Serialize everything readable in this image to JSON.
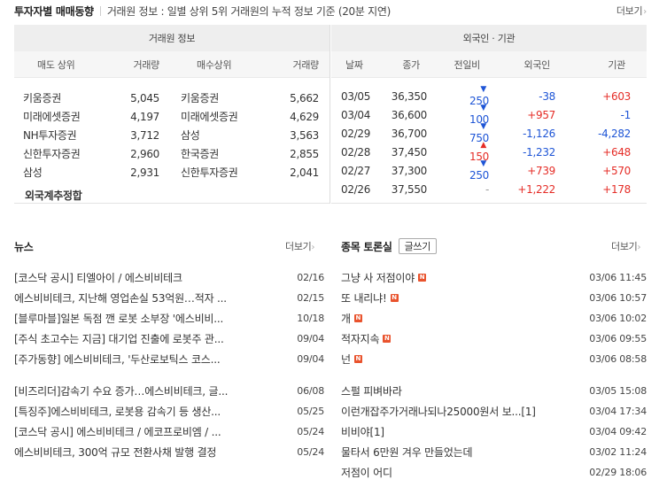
{
  "header": {
    "title": "투자자별 매매동향",
    "description": "거래원 정보 : 일별 상위 5위 거래원의 누적 정보 기준 (20분 지연)",
    "more_label": "더보기"
  },
  "broker": {
    "caption": "거래원 정보",
    "columns": [
      "매도 상위",
      "거래량",
      "매수상위",
      "거래량"
    ],
    "rows": [
      {
        "sell_name": "키움증권",
        "sell_vol": "5,045",
        "buy_name": "키움증권",
        "buy_vol": "5,662"
      },
      {
        "sell_name": "미래에셋증권",
        "sell_vol": "4,197",
        "buy_name": "미래에셋증권",
        "buy_vol": "4,629"
      },
      {
        "sell_name": "NH투자증권",
        "sell_vol": "3,712",
        "buy_name": "삼성",
        "buy_vol": "3,563"
      },
      {
        "sell_name": "신한투자증권",
        "sell_vol": "2,960",
        "buy_name": "한국증권",
        "buy_vol": "2,855"
      },
      {
        "sell_name": "삼성",
        "sell_vol": "2,931",
        "buy_name": "신한투자증권",
        "buy_vol": "2,041"
      }
    ],
    "foreign_label": "외국계추정합"
  },
  "foreign": {
    "caption": "외국인 · 기관",
    "columns": [
      "날짜",
      "종가",
      "전일비",
      "외국인",
      "기관"
    ],
    "rows": [
      {
        "date": "03/05",
        "close": "36,350",
        "dir": "down",
        "change": "250",
        "foreign": "-38",
        "inst": "+603"
      },
      {
        "date": "03/04",
        "close": "36,600",
        "dir": "down",
        "change": "100",
        "foreign": "+957",
        "inst": "-1"
      },
      {
        "date": "02/29",
        "close": "36,700",
        "dir": "down",
        "change": "750",
        "foreign": "-1,126",
        "inst": "-4,282"
      },
      {
        "date": "02/28",
        "close": "37,450",
        "dir": "up",
        "change": "150",
        "foreign": "-1,232",
        "inst": "+648"
      },
      {
        "date": "02/27",
        "close": "37,300",
        "dir": "down",
        "change": "250",
        "foreign": "+739",
        "inst": "+570"
      },
      {
        "date": "02/26",
        "close": "37,550",
        "dir": "flat",
        "change": "-",
        "foreign": "+1,222",
        "inst": "+178"
      }
    ],
    "colors": {
      "up": "#e52d27",
      "down": "#1e55d6"
    }
  },
  "news": {
    "title": "뉴스",
    "more_label": "더보기",
    "items": [
      {
        "text": "[코스닥 공시] 티엘아이 / 에스비비테크",
        "date": "02/16"
      },
      {
        "text": "에스비비테크, 지난해 영업손실 53억원…적자 ...",
        "date": "02/15"
      },
      {
        "text": "[블루마블]일본 독점 깬 로봇 소부장 '에스비비...",
        "date": "10/18"
      },
      {
        "text": "[주식 초고수는 지금] 대기업 진출에 로봇주 관...",
        "date": "09/04"
      },
      {
        "text": "[주가동향] 에스비비테크, '두산로보틱스 코스...",
        "date": "09/04"
      },
      {
        "text": "[비즈리더]감속기 수요 증가…에스비비테크, 글...",
        "date": "06/08"
      },
      {
        "text": "[특징주]에스비비테크, 로봇용 감속기 등 생산...",
        "date": "05/25"
      },
      {
        "text": "[코스닥 공시] 에스비비테크 / 에코프로비엠 / ...",
        "date": "05/24"
      },
      {
        "text": "에스비비테크, 300억 규모 전환사채 발행 결정",
        "date": "05/24"
      }
    ]
  },
  "forum": {
    "title": "종목 토론실",
    "write_label": "글쓰기",
    "more_label": "더보기",
    "new_badge": "N",
    "items": [
      {
        "text": "그냥 사 저점이야",
        "date": "03/06 11:45",
        "new": true
      },
      {
        "text": "또 내리냐!",
        "date": "03/06 10:57",
        "new": true
      },
      {
        "text": "개",
        "date": "03/06 10:02",
        "new": true
      },
      {
        "text": "적자지속",
        "date": "03/06 09:55",
        "new": true
      },
      {
        "text": "넌",
        "date": "03/06 08:58",
        "new": true
      },
      {
        "text": "스펄 피벼바라",
        "date": "03/05 15:08",
        "new": false
      },
      {
        "text": "이런개잡주가거래나되나25000원서 보...[1]",
        "date": "03/04 17:34",
        "new": false
      },
      {
        "text": "비비야[1]",
        "date": "03/04 09:42",
        "new": false
      },
      {
        "text": "물타서 6만원 겨우 만들었는데",
        "date": "03/02 11:24",
        "new": false
      },
      {
        "text": "저점이 어디",
        "date": "02/29 18:06",
        "new": false
      }
    ]
  }
}
